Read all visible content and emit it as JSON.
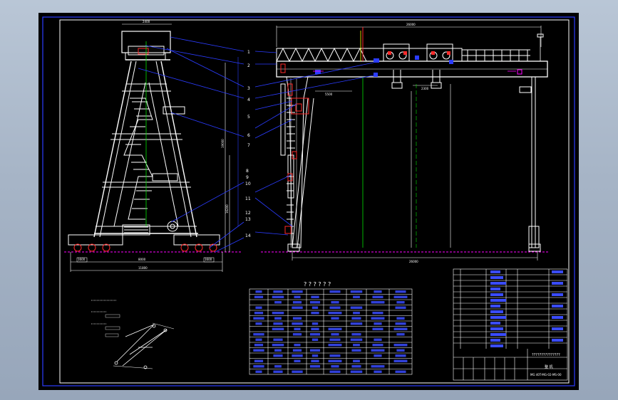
{
  "drawing": {
    "table_title": "? ? ? ? ? ?",
    "title_block_heading": "???????????????",
    "title_block_name": "整 机",
    "title_block_code": "MG 40T-MG-02-MS-00"
  },
  "part_numbers": [
    "1",
    "2",
    "3",
    "4",
    "5",
    "6",
    "7",
    "8",
    "9",
    "10",
    "11",
    "12",
    "13",
    "14"
  ],
  "dimensions": {
    "top_width": "2400",
    "span": "26000",
    "bottom_overall": "8000",
    "height": "19000",
    "column_height": "16200",
    "cantilever": "5500",
    "left_wheel": "1600",
    "right_wheel": "1600",
    "base_span": "11800",
    "trolley_gauge": "2300"
  },
  "colors": {
    "frame": "#2b3cff",
    "structure": "#ffffff",
    "accent": "#ff2a2a",
    "center": "#00e000",
    "magenta": "#ff00ff",
    "yellow": "#ffff00"
  }
}
